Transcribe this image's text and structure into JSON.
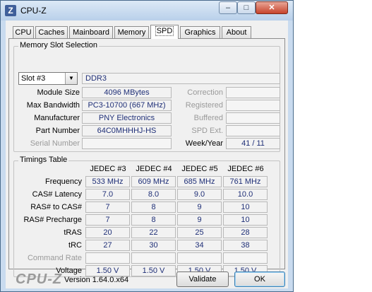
{
  "window": {
    "title": "CPU-Z",
    "icon_letter": "Z",
    "buttons": [
      "–",
      "□",
      "✕"
    ]
  },
  "tabs": [
    "CPU",
    "Caches",
    "Mainboard",
    "Memory",
    "SPD",
    "Graphics",
    "About"
  ],
  "active_tab": "SPD",
  "slot_section": {
    "title": "Memory Slot Selection",
    "slot_select": "Slot #3",
    "memory_type": "DDR3",
    "left_fields": [
      {
        "label": "Module Size",
        "value": "4096 MBytes",
        "enabled": true
      },
      {
        "label": "Max Bandwidth",
        "value": "PC3-10700 (667 MHz)",
        "enabled": true
      },
      {
        "label": "Manufacturer",
        "value": "PNY Electronics",
        "enabled": true
      },
      {
        "label": "Part Number",
        "value": "64C0MHHHJ-HS",
        "enabled": true
      },
      {
        "label": "Serial Number",
        "value": "",
        "enabled": false
      }
    ],
    "right_fields": [
      {
        "label": "Correction",
        "value": "",
        "enabled": false
      },
      {
        "label": "Registered",
        "value": "",
        "enabled": false
      },
      {
        "label": "Buffered",
        "value": "",
        "enabled": false
      },
      {
        "label": "SPD Ext.",
        "value": "",
        "enabled": false
      },
      {
        "label": "Week/Year",
        "value": "41 / 11",
        "enabled": true
      }
    ]
  },
  "timings": {
    "title": "Timings Table",
    "columns": [
      "JEDEC #3",
      "JEDEC #4",
      "JEDEC #5",
      "JEDEC #6"
    ],
    "rows": [
      {
        "label": "Frequency",
        "values": [
          "533 MHz",
          "609 MHz",
          "685 MHz",
          "761 MHz"
        ],
        "enabled": true
      },
      {
        "label": "CAS# Latency",
        "values": [
          "7.0",
          "8.0",
          "9.0",
          "10.0"
        ],
        "enabled": true
      },
      {
        "label": "RAS# to CAS#",
        "values": [
          "7",
          "8",
          "9",
          "10"
        ],
        "enabled": true
      },
      {
        "label": "RAS# Precharge",
        "values": [
          "7",
          "8",
          "9",
          "10"
        ],
        "enabled": true
      },
      {
        "label": "tRAS",
        "values": [
          "20",
          "22",
          "25",
          "28"
        ],
        "enabled": true
      },
      {
        "label": "tRC",
        "values": [
          "27",
          "30",
          "34",
          "38"
        ],
        "enabled": true
      },
      {
        "label": "Command Rate",
        "values": [
          "",
          "",
          "",
          ""
        ],
        "enabled": false
      },
      {
        "label": "Voltage",
        "values": [
          "1.50 V",
          "1.50 V",
          "1.50 V",
          "1.50 V"
        ],
        "enabled": true
      }
    ]
  },
  "footer": {
    "logo": "CPU-Z",
    "version": "Version 1.64.0.x64",
    "validate_label": "Validate",
    "ok_label": "OK"
  },
  "colors": {
    "value_text": "#1f2f77",
    "frame": "#c9dbef"
  }
}
